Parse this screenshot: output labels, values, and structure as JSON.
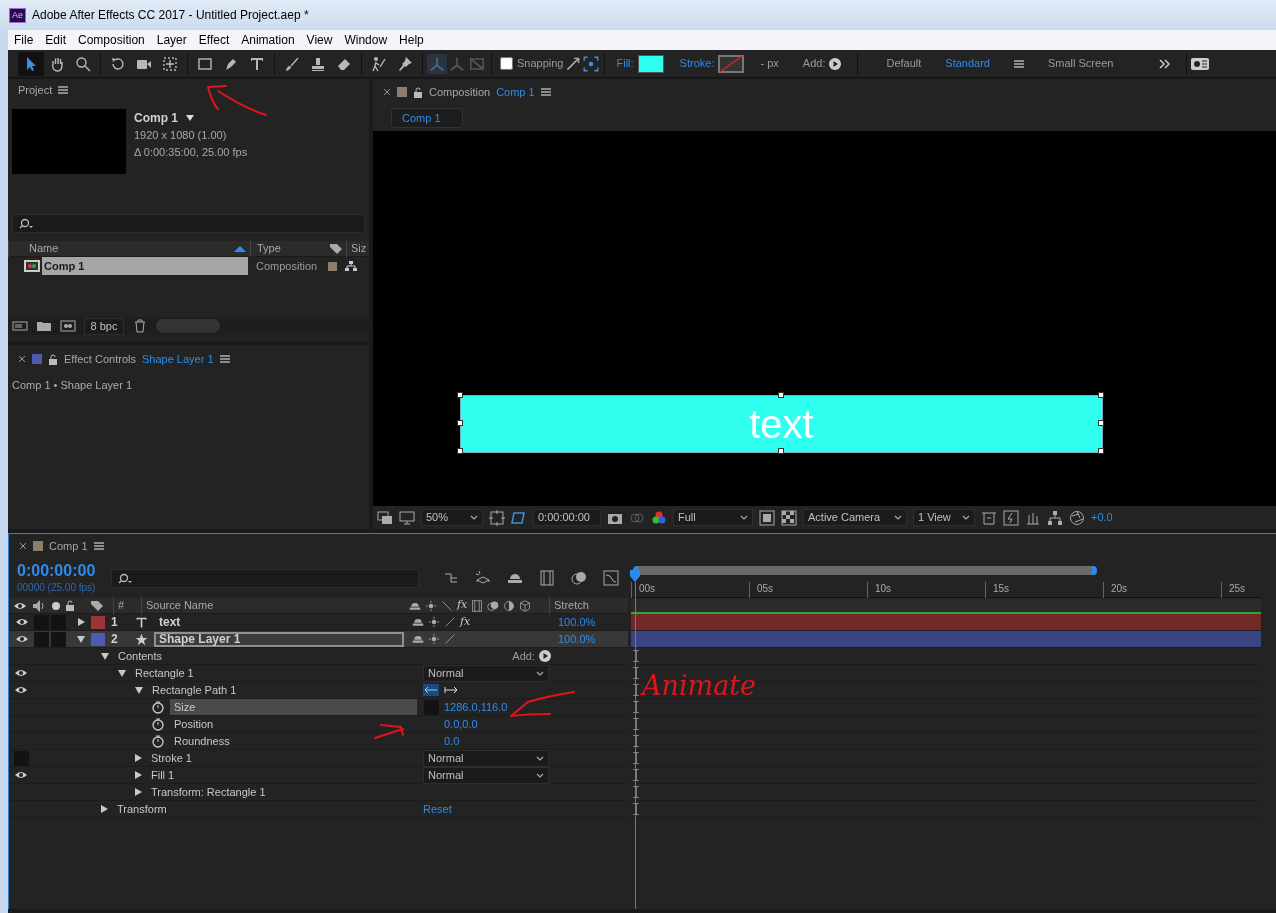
{
  "window": {
    "app_badge": "Ae",
    "title": "Adobe After Effects CC 2017 - Untitled Project.aep *"
  },
  "menu": [
    "File",
    "Edit",
    "Composition",
    "Layer",
    "Effect",
    "Animation",
    "View",
    "Window",
    "Help"
  ],
  "toolbar": {
    "tools": [
      {
        "kind": "selection",
        "selected": true
      },
      {
        "kind": "hand",
        "selected": false
      },
      {
        "kind": "zoom",
        "selected": false
      },
      {
        "kind": "rotate",
        "selected": false
      },
      {
        "kind": "camera",
        "selected": false
      },
      {
        "kind": "pan",
        "selected": false
      },
      {
        "kind": "rectangle",
        "selected": false
      },
      {
        "kind": "pen",
        "selected": false
      },
      {
        "kind": "type",
        "selected": false
      },
      {
        "kind": "brush",
        "selected": false
      },
      {
        "kind": "stamp",
        "selected": false
      },
      {
        "kind": "eraser",
        "selected": false
      },
      {
        "kind": "roto",
        "selected": false
      },
      {
        "kind": "pin",
        "selected": false
      }
    ],
    "snapping": {
      "label": "Snapping",
      "checked": false
    },
    "fill_label": "Fill:",
    "stroke_label": "Stroke:",
    "stroke_width": "- px",
    "add_label": "Add:",
    "workspaces": [
      {
        "label": "Default",
        "selected": false
      },
      {
        "label": "Standard",
        "selected": true
      },
      {
        "label": "Small Screen",
        "selected": false
      }
    ]
  },
  "project": {
    "title": "Project",
    "comp_name": "Comp 1",
    "resolution": "1920 x 1080 (1.00)",
    "duration": "Δ 0:00:35:00, 25.00 fps",
    "columns": [
      "Name",
      "Type",
      "Siz"
    ],
    "items": [
      {
        "name": "Comp 1",
        "type": "Composition",
        "selected": true
      }
    ],
    "bpc": "8 bpc"
  },
  "effect_controls": {
    "title": "Effect Controls",
    "layer": "Shape Layer 1",
    "breadcrumb": "Comp 1 • Shape Layer 1"
  },
  "composition": {
    "title": "Composition",
    "name": "Comp 1",
    "tab": "Comp 1",
    "shape_text": "text",
    "zoom": "50%",
    "timecode": "0:00:00:00",
    "resolution": "Full",
    "camera": "Active Camera",
    "views": "1 View",
    "exposure": "+0.0"
  },
  "timeline": {
    "tab": "Comp 1",
    "timecode": "0:00:00:00",
    "frame_info": "00000 (25.00 fps)",
    "columns": {
      "number": "#",
      "source_name": "Source Name",
      "fx": "fx",
      "stretch": "Stretch"
    },
    "ruler": [
      "00s",
      "05s",
      "10s",
      "15s",
      "20s",
      "25s"
    ],
    "layers": [
      {
        "number": "1",
        "name": "text",
        "kind": "text",
        "color": "#9c3535",
        "stretch": "100.0%",
        "expanded": false,
        "selected": false,
        "fx": "fx"
      },
      {
        "number": "2",
        "name": "Shape Layer 1",
        "kind": "shape",
        "color": "#4c5bb0",
        "stretch": "100.0%",
        "expanded": true,
        "selected": true
      }
    ],
    "add_label": "Add:",
    "properties": [
      {
        "name": "Contents",
        "expanded": true,
        "children": [
          {
            "name": "Rectangle 1",
            "expanded": true,
            "visible": true,
            "mode": "Normal",
            "children": [
              {
                "name": "Rectangle Path 1",
                "expanded": true,
                "visible": true,
                "children": [
                  {
                    "name": "Size",
                    "value": "1286.0,116.0",
                    "selected": true
                  },
                  {
                    "name": "Position",
                    "value": "0.0,0.0",
                    "selected": false
                  },
                  {
                    "name": "Roundness",
                    "value": "0.0",
                    "selected": false
                  }
                ]
              },
              {
                "name": "Stroke 1",
                "expanded": false,
                "visible": false,
                "mode": "Normal"
              },
              {
                "name": "Fill 1",
                "expanded": false,
                "visible": true,
                "mode": "Normal"
              },
              {
                "name": "Transform: Rectangle 1",
                "expanded": false
              }
            ]
          }
        ]
      },
      {
        "name": "Transform",
        "expanded": false,
        "value": "Reset"
      }
    ]
  },
  "annotations": [
    {
      "text": "Animate"
    }
  ]
}
